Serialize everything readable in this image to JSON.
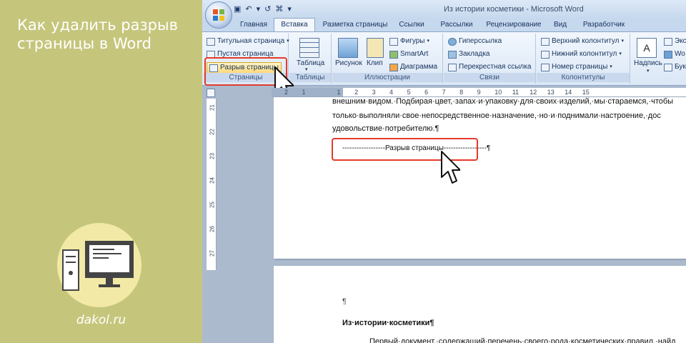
{
  "left_panel": {
    "title": "Как удалить разрыв страницы в Word",
    "site": "dakol.ru",
    "colors": {
      "background": "#c5c67c",
      "circle": "#f2e9a6",
      "text": "#ffffff"
    }
  },
  "window": {
    "title": "Из истории косметики - Microsoft Word",
    "tabs": [
      "Главная",
      "Вставка",
      "Разметка страницы",
      "Ссылки",
      "Рассылки",
      "Рецензирование",
      "Вид",
      "Разработчик"
    ],
    "active_tab": "Вставка"
  },
  "ribbon": {
    "pages": {
      "label": "Страницы",
      "items": [
        "Титульная страница",
        "Пустая страница",
        "Разрыв страницы"
      ]
    },
    "tables": {
      "label": "Таблицы",
      "table_label": "Таблица"
    },
    "illustrations": {
      "label": "Иллюстрации",
      "picture": "Рисунок",
      "clip": "Клип",
      "shapes": "Фигуры",
      "smartart": "SmartArt",
      "chart": "Диаграмма"
    },
    "links": {
      "label": "Связи",
      "items": [
        "Гиперссылка",
        "Закладка",
        "Перекрестная ссылка"
      ]
    },
    "header_footer": {
      "label": "Колонтитулы",
      "items": [
        "Верхний колонтитул",
        "Нижний колонтитул",
        "Номер страницы"
      ]
    },
    "text": {
      "inscription": "Надпись",
      "express": "Экс",
      "wo": "Wo",
      "bu": "Бук"
    }
  },
  "ruler": {
    "h_numbers": [
      "2",
      "1",
      "",
      "1",
      "2",
      "3",
      "4",
      "5",
      "6",
      "7",
      "8",
      "9",
      "10",
      "11",
      "12",
      "13",
      "14",
      "15"
    ],
    "v_numbers": [
      "21",
      "22",
      "23",
      "24",
      "25",
      "26",
      "27"
    ]
  },
  "document": {
    "lines": [
      "внешним·видом.·Подбирая·цвет,·запах·и·упаковку·для·своих·изделий,·мы·стараемся,·чтобы",
      "только·выполняли·свое·непосредственное·назначение,·но·и·поднимали·настроение,·дос",
      "удовольствие·потребителю.¶"
    ],
    "page_break": "------------------Разрыв страницы------------------¶",
    "page2_lines": [
      "¶",
      "Из·истории·косметики¶",
      "Первый·документ,·содержащий·перечень·своего·рода·косметических·правил,·найд"
    ]
  }
}
